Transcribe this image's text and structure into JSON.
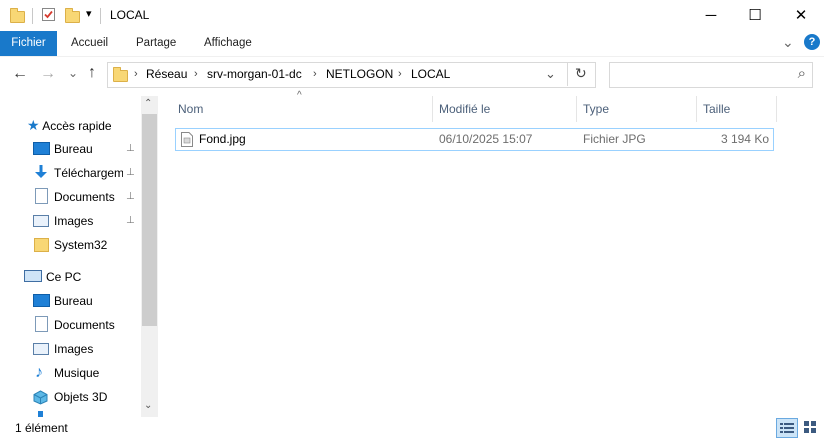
{
  "window": {
    "title": "LOCAL",
    "qa_dropdown_glyph": "▾",
    "controls": {
      "minimize": "─",
      "maximize": "☐",
      "close": "✕"
    }
  },
  "ribbon": {
    "tabs": [
      "Fichier",
      "Accueil",
      "Partage",
      "Affichage"
    ],
    "expand_glyph": "⌄",
    "help_glyph": "?"
  },
  "address": {
    "back": "←",
    "forward": "→",
    "recent": "⌄",
    "up": "↑",
    "breadcrumb": [
      "Réseau",
      "srv-morgan-01-dc",
      "NETLOGON",
      "LOCAL"
    ],
    "sep_glyph": "›",
    "dropdown_glyph": "⌄",
    "refresh_glyph": "↻",
    "search_placeholder": "",
    "search_icon": "⌕"
  },
  "sidebar": {
    "quick_access": "Accès rapide",
    "pinned": [
      {
        "label": "Bureau",
        "icon": "desktop-icon"
      },
      {
        "label": "Téléchargements",
        "icon": "download-icon"
      },
      {
        "label": "Documents",
        "icon": "documents-icon"
      },
      {
        "label": "Images",
        "icon": "images-icon"
      }
    ],
    "system32": "System32",
    "this_pc": "Ce PC",
    "pc_items": [
      {
        "label": "Bureau",
        "icon": "desktop-icon"
      },
      {
        "label": "Documents",
        "icon": "documents-icon"
      },
      {
        "label": "Images",
        "icon": "images-icon"
      },
      {
        "label": "Musique",
        "icon": "music-icon"
      },
      {
        "label": "Objets 3D",
        "icon": "3d-objects-icon"
      }
    ],
    "pin_glyph": "📌"
  },
  "scroll": {
    "up": "⌃",
    "down": "⌄"
  },
  "content": {
    "sort_glyph": "^",
    "columns": {
      "name": "Nom",
      "modified": "Modifié le",
      "type": "Type",
      "size": "Taille"
    },
    "files": [
      {
        "name": "Fond.jpg",
        "modified": "06/10/2025 15:07",
        "type": "Fichier JPG",
        "size": "3 194 Ko"
      }
    ]
  },
  "status": {
    "count": "1 élément"
  },
  "colors": {
    "accent": "#1979ca",
    "selection_border": "#99d1ff",
    "folder": "#f8d775",
    "header_text": "#4c607a"
  }
}
